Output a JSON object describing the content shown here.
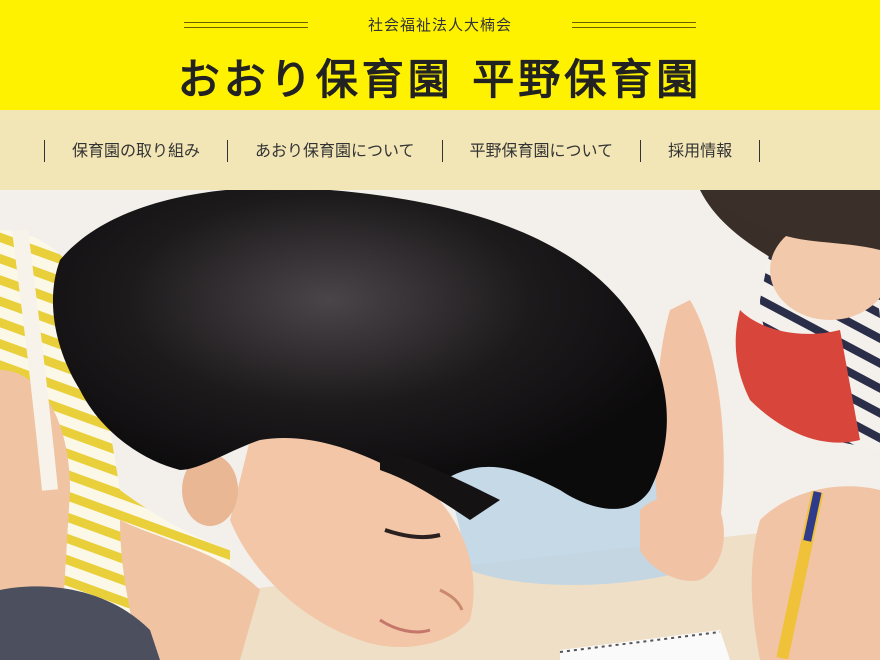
{
  "header": {
    "org_name": "社会福祉法人大楠会",
    "site_title": "おおり保育園 平野保育園"
  },
  "nav": {
    "items": [
      {
        "label": "保育園の取り組み"
      },
      {
        "label": "あおり保育園について"
      },
      {
        "label": "平野保育園について"
      },
      {
        "label": "採用情報"
      }
    ]
  },
  "colors": {
    "header_bg": "#fff200",
    "nav_bg": "#f2e6b7",
    "text": "#333333"
  }
}
